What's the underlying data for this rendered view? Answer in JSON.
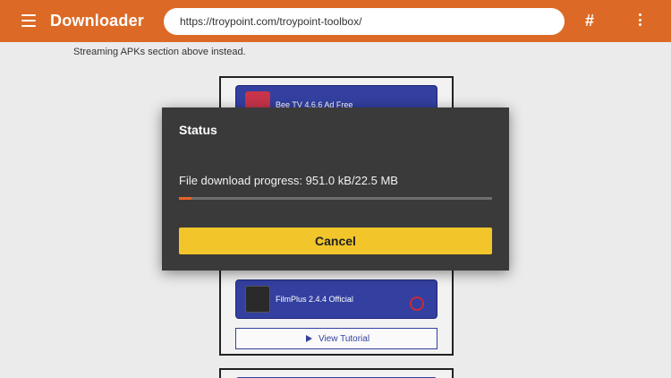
{
  "topbar": {
    "app_name": "Downloader",
    "url": "https://troypoint.com/troypoint-toolbox/",
    "menu_icon": "hamburger-menu-icon",
    "hash_label": "#",
    "more_icon": "kebab-menu-icon",
    "color": "#dc6a26"
  },
  "page": {
    "note": "Streaming APKs section above instead.",
    "apps": [
      {
        "label": "Bee TV 4.6.6 Ad Free"
      },
      {
        "label": "FilmPlus 2.4.4 Official"
      }
    ],
    "tutorial_label": "View Tutorial"
  },
  "dialog": {
    "title": "Status",
    "progress_text": "File download progress: 951.0 kB/22.5 MB",
    "progress_fraction": 0.0413,
    "cancel_label": "Cancel",
    "accent_color": "#f2c52b",
    "progress_color": "#e8632a"
  }
}
